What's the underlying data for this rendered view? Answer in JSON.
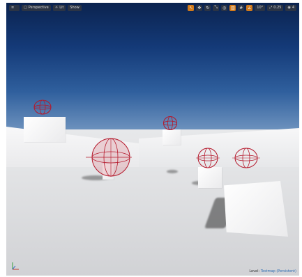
{
  "toolbar": {
    "menu_label": "≡",
    "perspective_label": "Perspective",
    "lit_label": "Lit",
    "show_label": "Show",
    "angle_value": "10°",
    "scale_value": "0.25",
    "speed_value": "4"
  },
  "status": {
    "level_prefix": "Level:",
    "level_name": "Testmap (Persistent)"
  },
  "colors": {
    "sky_top": "#0b234f",
    "sky_horizon": "#6c91bd",
    "ground": "#dcdddf",
    "gizmo": "#b5182b",
    "accent": "#d27a1a"
  }
}
